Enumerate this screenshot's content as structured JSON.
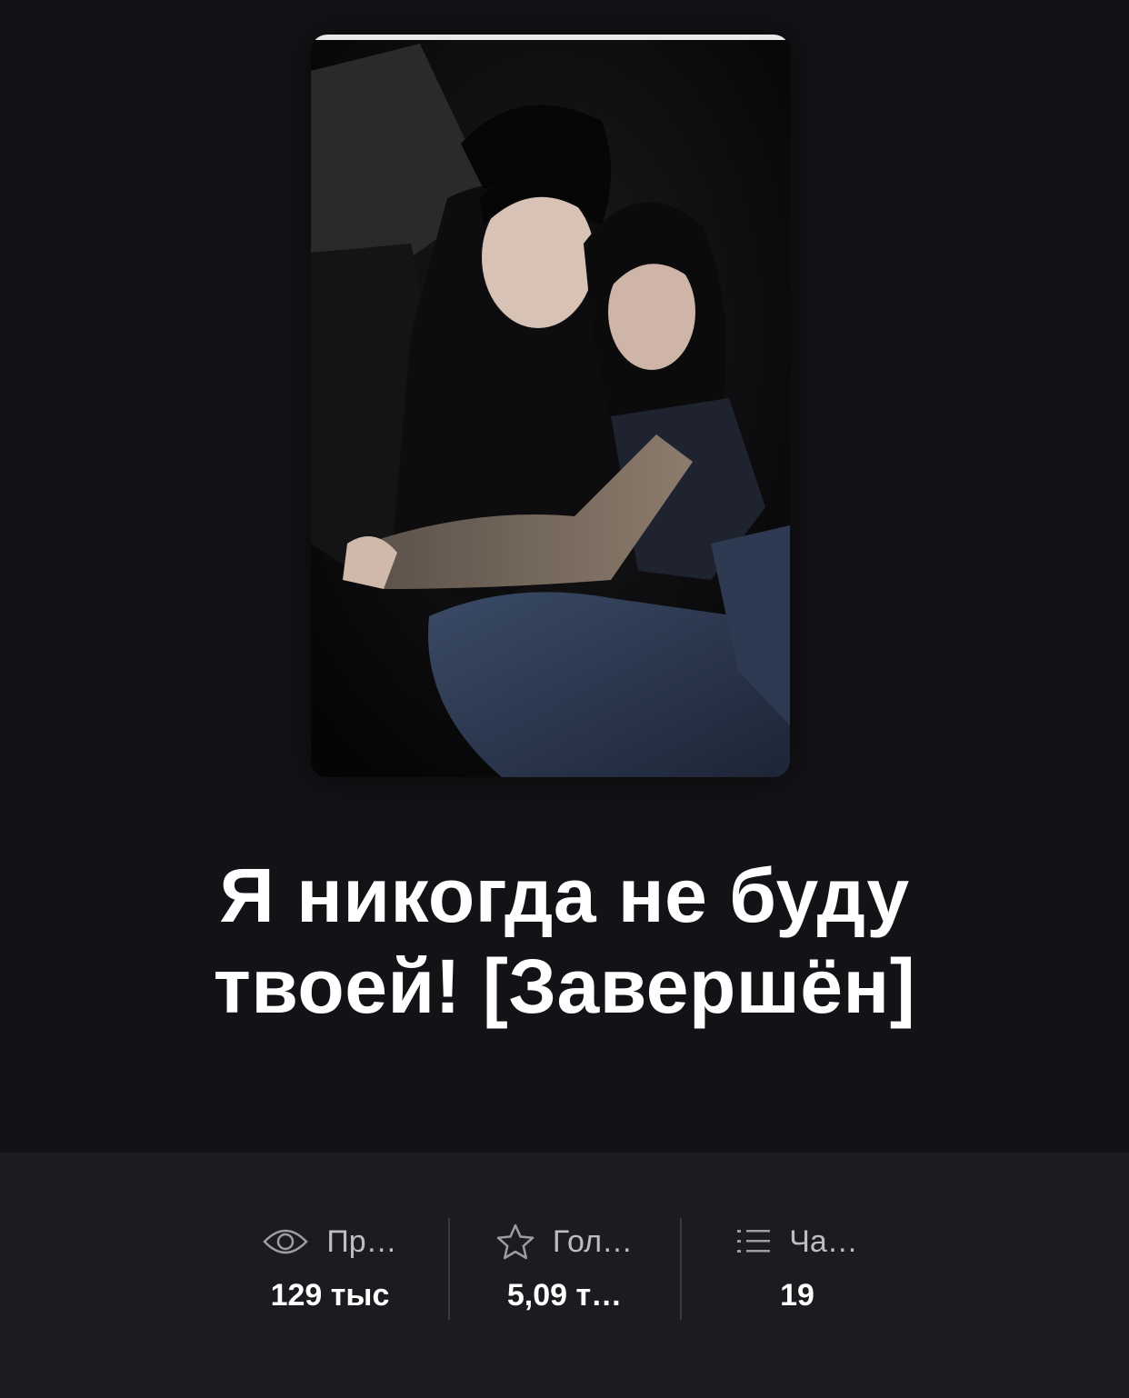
{
  "story": {
    "title": "Я никогда не буду твоей! [Завершён]",
    "cover_icon": "cover-image"
  },
  "stats": [
    {
      "icon": "eye-icon",
      "label": "Пр…",
      "value": "129 тыс"
    },
    {
      "icon": "star-icon",
      "label": "Гол…",
      "value": "5,09 т…"
    },
    {
      "icon": "list-icon",
      "label": "Ча…",
      "value": "19"
    }
  ],
  "colors": {
    "background": "#141216",
    "stats_panel": "#1c1b1f",
    "label": "#bdbdc3",
    "value": "#ffffff"
  }
}
